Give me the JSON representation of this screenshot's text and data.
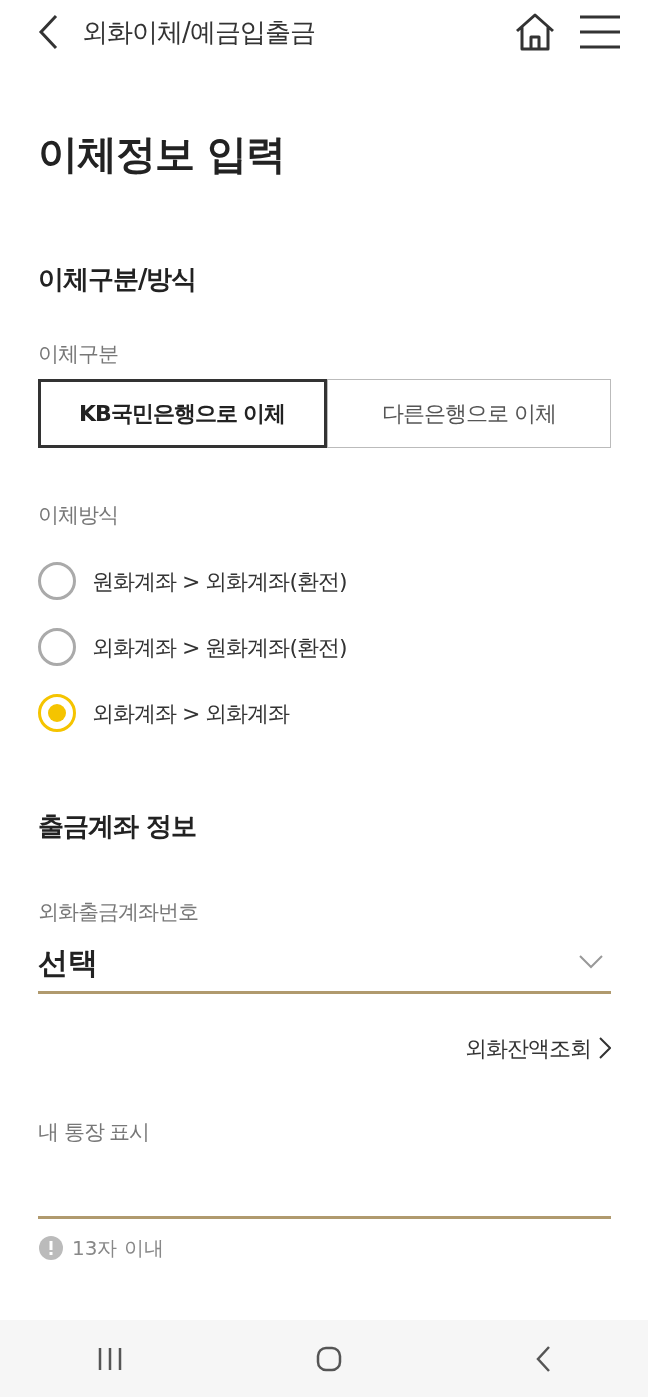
{
  "header": {
    "title": "외화이체/예금입출금"
  },
  "page_title": "이체정보 입력",
  "sections": [
    {
      "heading": "이체구분/방식",
      "transfer_type": {
        "label": "이체구분",
        "options": [
          {
            "label": "KB국민은행으로 이체",
            "selected": true
          },
          {
            "label": "다른은행으로 이체",
            "selected": false
          }
        ]
      },
      "transfer_method": {
        "label": "이체방식",
        "options": [
          {
            "label": "원화계좌 > 외화계좌(환전)",
            "selected": false
          },
          {
            "label": "외화계좌 > 원화계좌(환전)",
            "selected": false
          },
          {
            "label": "외화계좌 > 외화계좌",
            "selected": true
          }
        ]
      }
    },
    {
      "heading": "출금계좌 정보",
      "account": {
        "label": "외화출금계좌번호",
        "value": "선택"
      },
      "balance_link": "외화잔액조회",
      "memo": {
        "label": "내 통장 표시",
        "hint": "13자 이내"
      }
    }
  ]
}
